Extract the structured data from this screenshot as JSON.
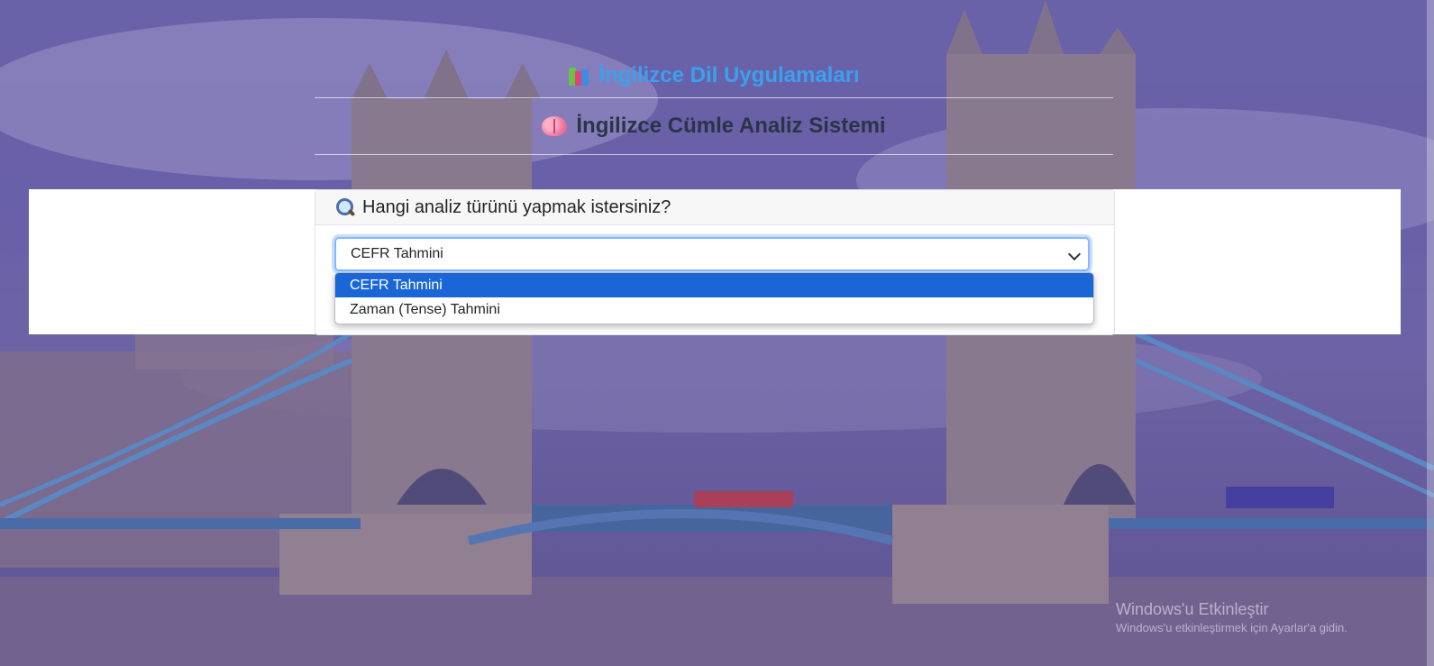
{
  "header": {
    "app_title": "İngilizce Dil Uygulamaları",
    "sub_title": "İngilizce Cümle Analiz Sistemi"
  },
  "card": {
    "question": "Hangi analiz türünü yapmak istersiniz?"
  },
  "select": {
    "value": "CEFR Tahmini",
    "options": [
      "CEFR Tahmini",
      "Zaman (Tense) Tahmini"
    ],
    "selected_index": 0
  },
  "watermark": {
    "line1": "Windows'u Etkinleştir",
    "line2": "Windows'u etkinleştirmek için Ayarlar'a gidin."
  },
  "colors": {
    "app_title": "#3aa0f0",
    "selected_option": "#1a66d6",
    "overlay": "#5f50a5"
  },
  "icons": {
    "app_title": "books-icon",
    "sub_title": "brain-icon",
    "question": "magnifying-glass-icon"
  }
}
